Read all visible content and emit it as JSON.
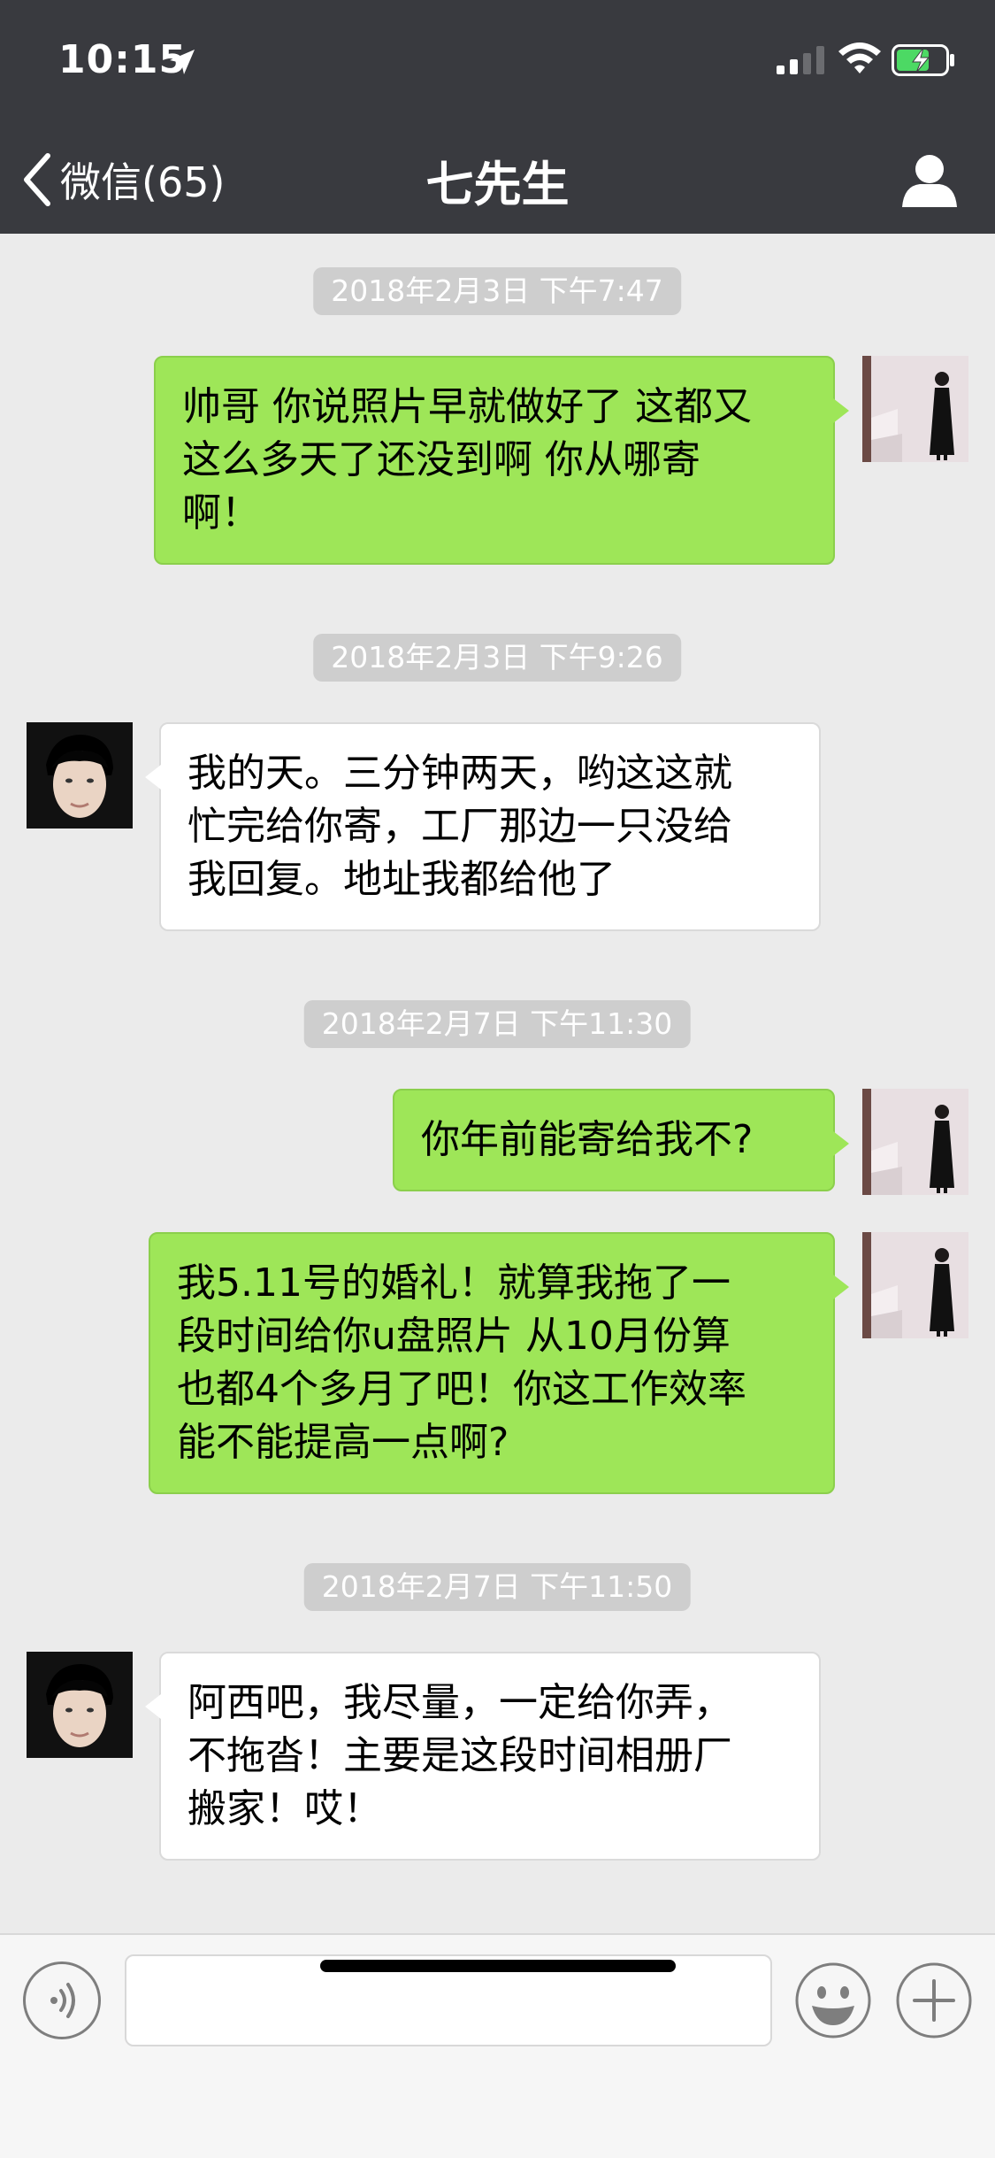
{
  "status_bar": {
    "time": "10:15"
  },
  "nav": {
    "back_label": "微信(65)",
    "title": "七先生"
  },
  "timestamps": [
    "2018年2月3日 下午7:47",
    "2018年2月3日 下午9:26",
    "2018年2月7日 下午11:30",
    "2018年2月7日 下午11:50"
  ],
  "messages": [
    {
      "from": "me",
      "lines": [
        "帅哥 你说照片早就做好了 这都又",
        "这么多天了还没到啊 你从哪寄",
        "啊！"
      ]
    },
    {
      "from": "other",
      "lines": [
        "我的天。三分钟两天，哟这这就",
        "忙完给你寄，工厂那边一只没给",
        "我回复。地址我都给他了"
      ]
    },
    {
      "from": "me",
      "lines": [
        "你年前能寄给我不?"
      ]
    },
    {
      "from": "me",
      "lines": [
        "我5.11号的婚礼！就算我拖了一",
        "段时间给你u盘照片 从10月份算",
        "也都4个多月了吧！你这工作效率",
        "能不能提高一点啊?"
      ]
    },
    {
      "from": "other",
      "lines": [
        "阿西吧，我尽量，一定给你弄，",
        "不拖沓！主要是这段时间相册厂",
        "搬家！哎！"
      ]
    }
  ],
  "colors": {
    "nav_bg": "#393a3f",
    "chat_bg": "#ebebeb",
    "my_bubble": "#9ee658",
    "other_bubble": "#ffffff"
  },
  "icons": [
    "location-arrow-icon",
    "signal-icon",
    "wifi-icon",
    "battery-charging-icon",
    "back-chevron-icon",
    "person-icon",
    "voice-icon",
    "emoji-icon",
    "plus-icon"
  ]
}
